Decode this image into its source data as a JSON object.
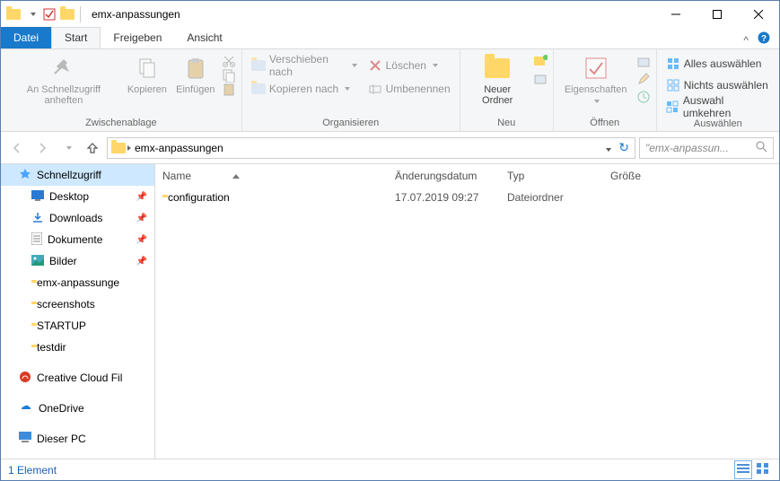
{
  "window": {
    "title": "emx-anpassungen"
  },
  "tabs": {
    "file": "Datei",
    "start": "Start",
    "share": "Freigeben",
    "view": "Ansicht"
  },
  "ribbon": {
    "clipboard": {
      "label": "Zwischenablage",
      "pin": "An Schnellzugriff anheften",
      "copy": "Kopieren",
      "paste": "Einfügen"
    },
    "organize": {
      "label": "Organisieren",
      "moveTo": "Verschieben nach",
      "copyTo": "Kopieren nach",
      "delete": "Löschen",
      "rename": "Umbenennen"
    },
    "new": {
      "label": "Neu",
      "newFolder": "Neuer Ordner"
    },
    "open": {
      "label": "Öffnen",
      "properties": "Eigenschaften"
    },
    "select": {
      "label": "Auswählen",
      "selectAll": "Alles auswählen",
      "selectNone": "Nichts auswählen",
      "invert": "Auswahl umkehren"
    }
  },
  "breadcrumb": {
    "current": "emx-anpassungen"
  },
  "search": {
    "placeholder": "\"emx-anpassun..."
  },
  "sidebar": {
    "items": [
      {
        "label": "Schnellzugriff"
      },
      {
        "label": "Desktop"
      },
      {
        "label": "Downloads"
      },
      {
        "label": "Dokumente"
      },
      {
        "label": "Bilder"
      },
      {
        "label": "emx-anpassunge"
      },
      {
        "label": "screenshots"
      },
      {
        "label": "STARTUP"
      },
      {
        "label": "testdir"
      },
      {
        "label": "Creative Cloud Fil"
      },
      {
        "label": "OneDrive"
      },
      {
        "label": "Dieser PC"
      }
    ]
  },
  "columns": {
    "name": "Name",
    "date": "Änderungsdatum",
    "type": "Typ",
    "size": "Größe"
  },
  "files": [
    {
      "name": "configuration",
      "date": "17.07.2019 09:27",
      "type": "Dateiordner"
    }
  ],
  "status": {
    "count": "1 Element"
  }
}
